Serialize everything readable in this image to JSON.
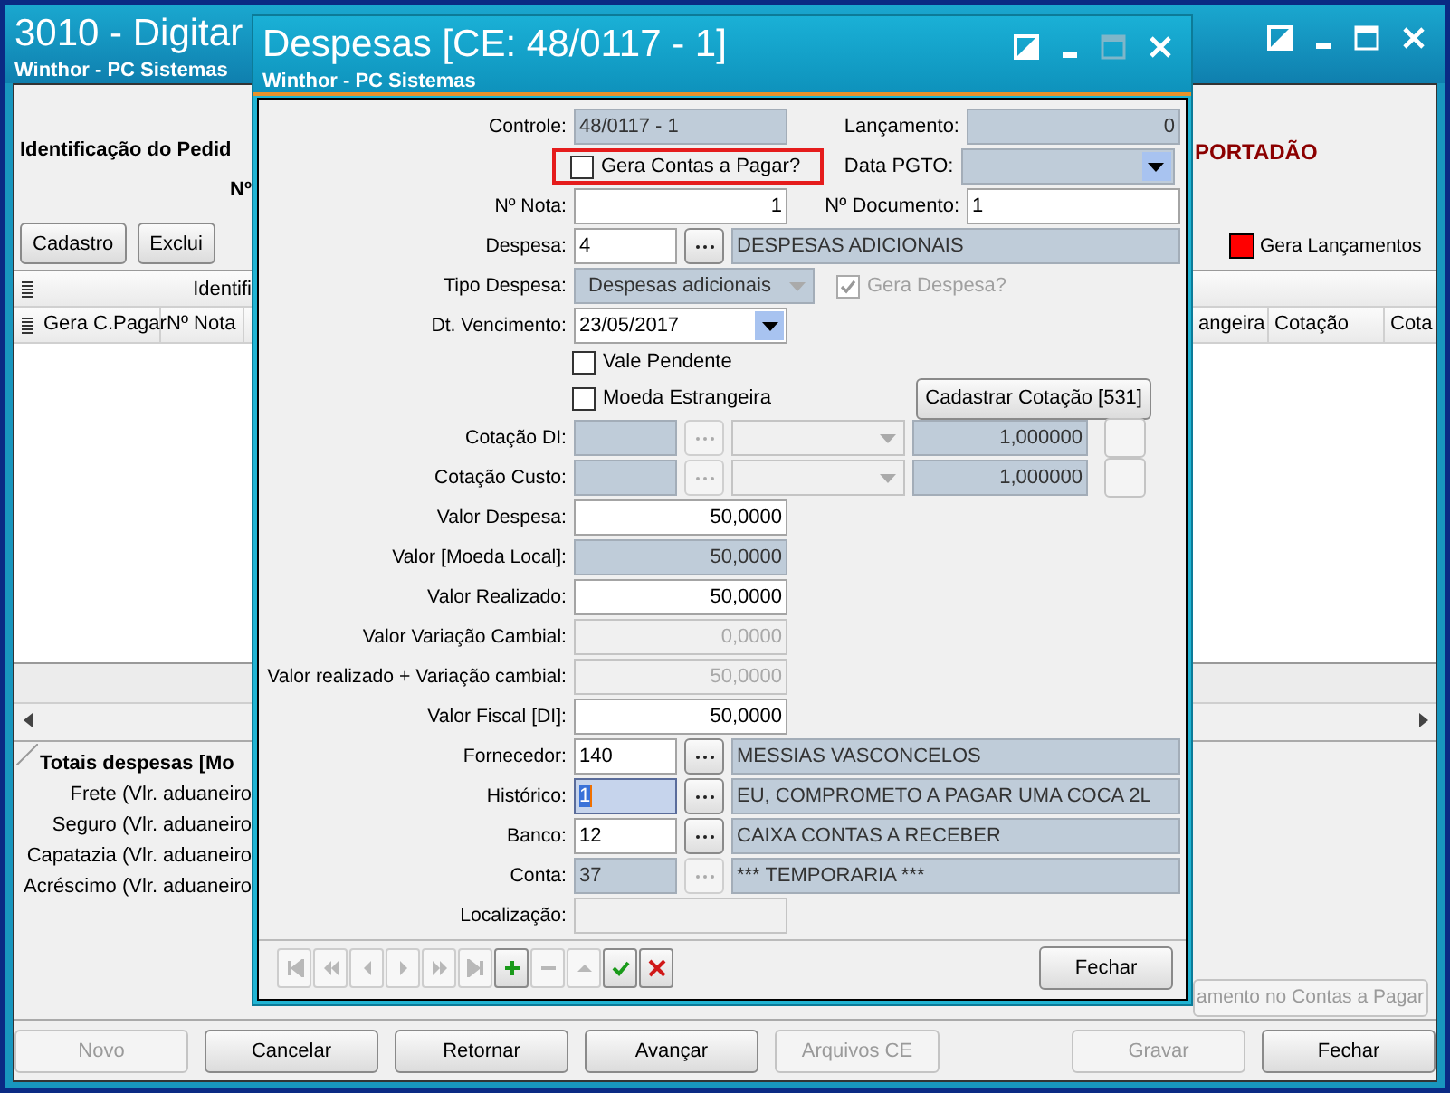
{
  "main_window": {
    "title": "3010 - Digitar",
    "subtitle": "Winthor - PC Sistemas",
    "maximize_disabled": false,
    "heading": "Identificação do Pedid",
    "status_text": "PORTADÃO",
    "number_label": "Nº",
    "toolbar_buttons": [
      {
        "label": "Cadastro",
        "disabled": false
      },
      {
        "label": "Exclui",
        "disabled": false
      }
    ],
    "legend": {
      "label": "Gera Lançamentos",
      "color": "#ff0000"
    },
    "table": {
      "group_header": "Identifi",
      "columns_left": [
        "Gera C.Pagar",
        "Nº Nota"
      ],
      "columns_right": [
        "angeira",
        "Cotação",
        "Cota"
      ]
    },
    "totals": {
      "title": "Totais despesas [Mo",
      "rows": [
        "Frete (Vlr. aduaneiro",
        "Seguro (Vlr. aduaneiro",
        "Capatazia (Vlr. aduaneiro",
        "Acréscimo (Vlr. aduaneiro"
      ]
    },
    "side_button": {
      "label": "amento no Contas a Pagar",
      "disabled": true
    },
    "footer_buttons_left": [
      {
        "label": "Novo",
        "disabled": true
      },
      {
        "label": "Cancelar",
        "disabled": false
      },
      {
        "label": "Retornar",
        "disabled": false
      },
      {
        "label": "Avançar",
        "disabled": false
      },
      {
        "label": "Arquivos CE",
        "disabled": true
      }
    ],
    "footer_buttons_right": [
      {
        "label": "Gravar",
        "disabled": true
      },
      {
        "label": "Fechar",
        "disabled": false
      }
    ]
  },
  "dialog": {
    "title": "Despesas [CE: 48/0117 - 1]",
    "subtitle": "Winthor - PC Sistemas",
    "maximize_disabled": true,
    "controle": {
      "label": "Controle:",
      "value": "48/0117 - 1",
      "kind": "readonly"
    },
    "lancamento": {
      "label": "Lançamento:",
      "value": "0",
      "kind": "readonly"
    },
    "gera_contas": {
      "label": "Gera Contas a Pagar?",
      "checked": false,
      "highlighted": true
    },
    "data_pgto": {
      "label": "Data PGTO:",
      "kind": "readonly",
      "dropdown_enabled": true
    },
    "nota": {
      "label": "Nº Nota:",
      "value": "1",
      "kind": "editable"
    },
    "documento": {
      "label": "Nº Documento:",
      "value": "1",
      "kind": "editable"
    },
    "despesa": {
      "label": "Despesa:",
      "code": "4",
      "name": "DESPESAS ADICIONAIS",
      "kind": "editable"
    },
    "tipo": {
      "label": "Tipo Despesa:",
      "value": "Despesas adicionais",
      "kind": "readonly",
      "dropdown_enabled": false
    },
    "gera_despesa": {
      "label": "Gera Despesa?",
      "checked": true,
      "disabled": true
    },
    "vencimento": {
      "label": "Dt. Vencimento:",
      "value": "23/05/2017",
      "kind": "editable",
      "dropdown_enabled": true
    },
    "vale_pendente": {
      "label": "Vale Pendente",
      "checked": false
    },
    "moeda_estrangeira": {
      "label": "Moeda Estrangeira",
      "checked": false
    },
    "cotacao_button": {
      "label": "Cadastrar Cotação [531]",
      "disabled": false
    },
    "cotacoes": [
      {
        "label": "Cotação DI:",
        "value": "1,000000"
      },
      {
        "label": "Cotação Custo:",
        "value": "1,000000"
      }
    ],
    "valores": [
      {
        "label": "Valor Despesa:",
        "value": "50,0000",
        "kind": "editable"
      },
      {
        "label": "Valor [Moeda Local]:",
        "value": "50,0000",
        "kind": "readonly"
      },
      {
        "label": "Valor Realizado:",
        "value": "50,0000",
        "kind": "editable"
      },
      {
        "label": "Valor Variação Cambial:",
        "value": "0,0000",
        "kind": "disabled"
      },
      {
        "label": "Valor realizado + Variação cambial:",
        "value": "50,0000",
        "kind": "disabled"
      },
      {
        "label": "Valor Fiscal [DI]:",
        "value": "50,0000",
        "kind": "editable"
      }
    ],
    "lookups": [
      {
        "label": "Fornecedor:",
        "code": "140",
        "name": "MESSIAS VASCONCELOS",
        "kind": "editable"
      },
      {
        "label": "Histórico:",
        "code": "1",
        "name": "EU, COMPROMETO A PAGAR UMA COCA 2L",
        "kind": "focused"
      },
      {
        "label": "Banco:",
        "code": "12",
        "name": "CAIXA CONTAS A RECEBER",
        "kind": "editable"
      },
      {
        "label": "Conta:",
        "code": "37",
        "name": "*** TEMPORARIA ***",
        "kind": "readonly"
      }
    ],
    "localizacao": {
      "label": "Localização:",
      "kind": "disabled"
    },
    "nav_buttons": [
      {
        "kind": "first",
        "disabled": true
      },
      {
        "kind": "prev-page",
        "disabled": true
      },
      {
        "kind": "prev",
        "disabled": true
      },
      {
        "kind": "next",
        "disabled": true
      },
      {
        "kind": "next-page",
        "disabled": true
      },
      {
        "kind": "last",
        "disabled": true
      },
      {
        "kind": "add",
        "disabled": false
      },
      {
        "kind": "remove",
        "disabled": true
      },
      {
        "kind": "up",
        "disabled": true
      },
      {
        "kind": "confirm",
        "disabled": false
      },
      {
        "kind": "cancel",
        "disabled": false
      }
    ],
    "close_button": {
      "label": "Fechar",
      "disabled": false
    }
  }
}
